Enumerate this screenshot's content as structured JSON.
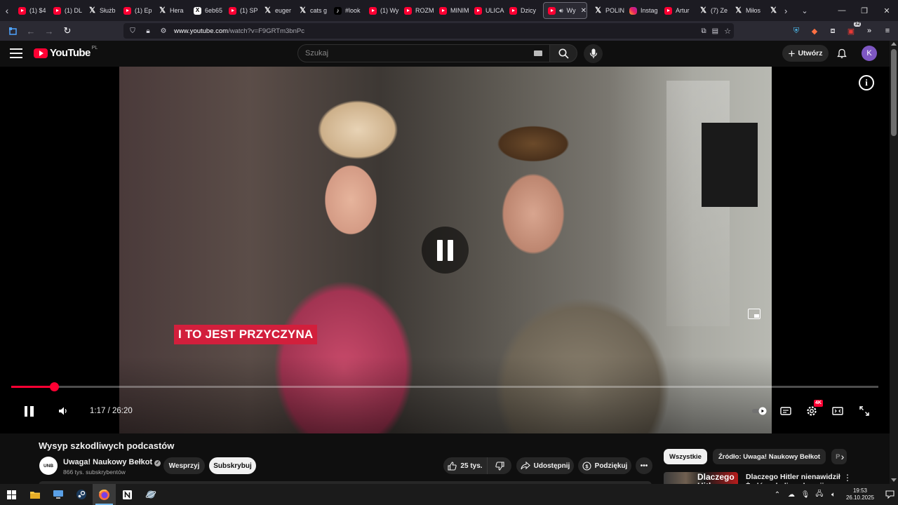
{
  "browser": {
    "tabs": [
      {
        "icon": "youtube-icon",
        "label": "(1) $4"
      },
      {
        "icon": "youtube-icon",
        "label": "(1) DL"
      },
      {
        "icon": "x-icon",
        "label": "Służb"
      },
      {
        "icon": "youtube-icon",
        "label": "(1) Ep"
      },
      {
        "icon": "x-icon",
        "label": "Hera"
      },
      {
        "icon": "x-square-icon",
        "label": "6eb65"
      },
      {
        "icon": "youtube-icon",
        "label": "(1) SP"
      },
      {
        "icon": "x-icon",
        "label": "euger"
      },
      {
        "icon": "x-icon",
        "label": "cats g"
      },
      {
        "icon": "tiktok-icon",
        "label": "#look"
      },
      {
        "icon": "youtube-icon",
        "label": "(1) Wy"
      },
      {
        "icon": "youtube-icon",
        "label": "ROZM"
      },
      {
        "icon": "youtube-icon",
        "label": "MINIM"
      },
      {
        "icon": "youtube-icon",
        "label": "ULICA"
      },
      {
        "icon": "youtube-icon",
        "label": "Dzicy"
      },
      {
        "icon": "youtube-icon",
        "label": "Wy",
        "active": true
      },
      {
        "icon": "x-icon",
        "label": "POLIN"
      },
      {
        "icon": "instagram-icon",
        "label": "Instag"
      },
      {
        "icon": "youtube-icon",
        "label": "Artur"
      },
      {
        "icon": "x-icon",
        "label": "(7) Ze"
      },
      {
        "icon": "x-icon",
        "label": "Miłos"
      },
      {
        "icon": "x-icon",
        "label": ""
      }
    ],
    "url_host": "www.youtube.com",
    "url_path": "/watch?v=F9GRTm3bnPc",
    "extension_badge": "32"
  },
  "youtube": {
    "logo_word": "YouTube",
    "logo_country": "PL",
    "search_placeholder": "Szukaj",
    "create_label": "Utwórz",
    "avatar_letter": "K"
  },
  "player": {
    "caption_text": "I TO JEST PRZYCZYNA",
    "current_time": "1:17",
    "duration": "26:20",
    "progress_fraction": 0.049,
    "quality_badge": "4K"
  },
  "video": {
    "title": "Wysyp szkodliwych podcastów",
    "channel_avatar_text": "UNB",
    "channel_name": "Uwaga! Naukowy Bełkot",
    "subscribers": "866 tys. subskrybentów",
    "join_label": "Wesprzyj",
    "subscribe_label": "Subskrybuj",
    "likes": "25 tys.",
    "share_label": "Udostępnij",
    "thanks_label": "Podziękuj"
  },
  "sidebar": {
    "chips": [
      "Wszystkie",
      "Źródło: Uwaga! Naukowy Bełkot",
      "P"
    ],
    "recommendation": {
      "thumb_text": "Dlaczego Hitler",
      "title": "Dlaczego Hitler nienawidził Żydów - kulisy obsesji"
    }
  },
  "taskbar": {
    "time": "19:53",
    "date": "26.10.2025"
  },
  "colors": {
    "youtube_red": "#ff0033",
    "caption_bg": "#d21f3c",
    "page_bg": "#0f0f0f"
  }
}
